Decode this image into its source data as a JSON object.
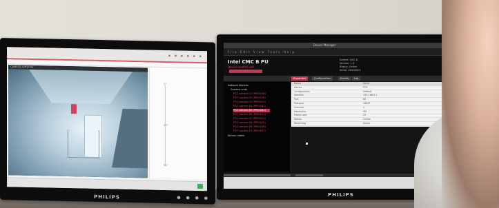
{
  "left_monitor": {
    "brand": "PHILIPS",
    "camera_header": "CAM 01 / PTZ 01",
    "ruler_marks": [
      "0°",
      "45°",
      "90°"
    ]
  },
  "right_monitor": {
    "brand": "PHILIPS",
    "window_title": "Device Manager",
    "toolbar_text": "File  Edit  View  Tools  Help",
    "app_title": "Intel CMC B PU",
    "app_subtitle": "Device control unit",
    "info_lines": [
      "Device:   CMC B",
      "Version:  1.0",
      "Status:   Online",
      "Serial:   00000001"
    ],
    "tabs": [
      "Properties",
      "Configuration",
      "Events",
      "Log"
    ],
    "tree": {
      "root": "Network devices",
      "group": "Camera units",
      "children": [
        "PTZ camera 01 (PPE0018)",
        "PTZ camera 02 (PPE0019)",
        "PTZ camera 03 (PPE0020)",
        "PTZ camera 04 (PPE0021)",
        "PTZ camera 05 (PPE0022)",
        "PTZ camera 06 (PPE0023)",
        "PTZ camera 07 (PPE0024)",
        "PTZ camera 08 (PPE0025)",
        "PTZ camera 09 (PPE0026)",
        "PTZ camera 10 (PPE0027)"
      ],
      "footer": "Sensor nodes"
    },
    "properties": [
      {
        "k": "Name",
        "v": "Value"
      },
      {
        "k": "Device",
        "v": "PTZ"
      },
      {
        "k": "Configuration",
        "v": "Default"
      },
      {
        "k": "Address",
        "v": "192.168.0.1"
      },
      {
        "k": "Port",
        "v": "80"
      },
      {
        "k": "Protocol",
        "v": "ONVIF"
      },
      {
        "k": "Channel",
        "v": "1"
      },
      {
        "k": "Resolution",
        "v": "HD"
      },
      {
        "k": "Frame rate",
        "v": "25"
      },
      {
        "k": "Status",
        "v": "Online"
      },
      {
        "k": "Recording",
        "v": "Active"
      }
    ]
  }
}
